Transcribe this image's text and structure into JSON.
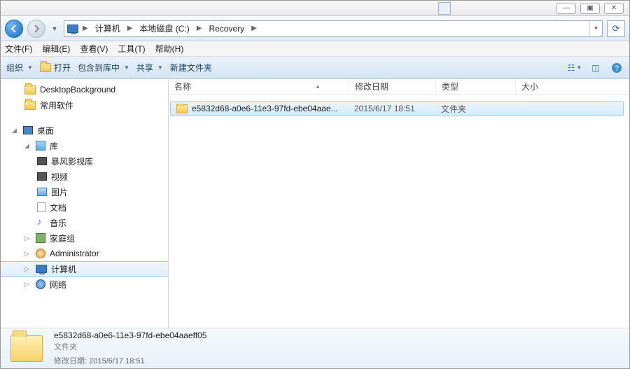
{
  "titlebar": {
    "min": "—",
    "max": "▣",
    "close": "✕"
  },
  "breadcrumb": {
    "root_icon": "computer",
    "items": [
      "计算机",
      "本地磁盘 (C:)",
      "Recovery"
    ]
  },
  "refresh_glyph": "⟳",
  "menu": {
    "file": "文件(F)",
    "edit": "编辑(E)",
    "view": "查看(V)",
    "tools": "工具(T)",
    "help": "帮助(H)"
  },
  "toolbar": {
    "organize": "组织",
    "open": "打开",
    "include": "包含到库中",
    "share": "共享",
    "newfolder": "新建文件夹"
  },
  "tree": {
    "desktop_bg": "DesktopBackground",
    "common_sw": "常用软件",
    "desktop": "桌面",
    "libraries": "库",
    "lib_storm": "暴风影视库",
    "lib_video": "视频",
    "lib_pic": "图片",
    "lib_doc": "文档",
    "lib_music": "音乐",
    "homegroup": "家庭组",
    "admin": "Administrator",
    "computer": "计算机",
    "network": "网络"
  },
  "columns": {
    "name": "名称",
    "date": "修改日期",
    "type": "类型",
    "size": "大小"
  },
  "rows": [
    {
      "name": "e5832d68-a0e6-11e3-97fd-ebe04aae...",
      "date": "2015/6/17 18:51",
      "type": "文件夹"
    }
  ],
  "details": {
    "name": "e5832d68-a0e6-11e3-97fd-ebe04aaeff05",
    "type": "文件夹",
    "date_label": "修改日期:",
    "date": "2015/6/17 18:51"
  }
}
